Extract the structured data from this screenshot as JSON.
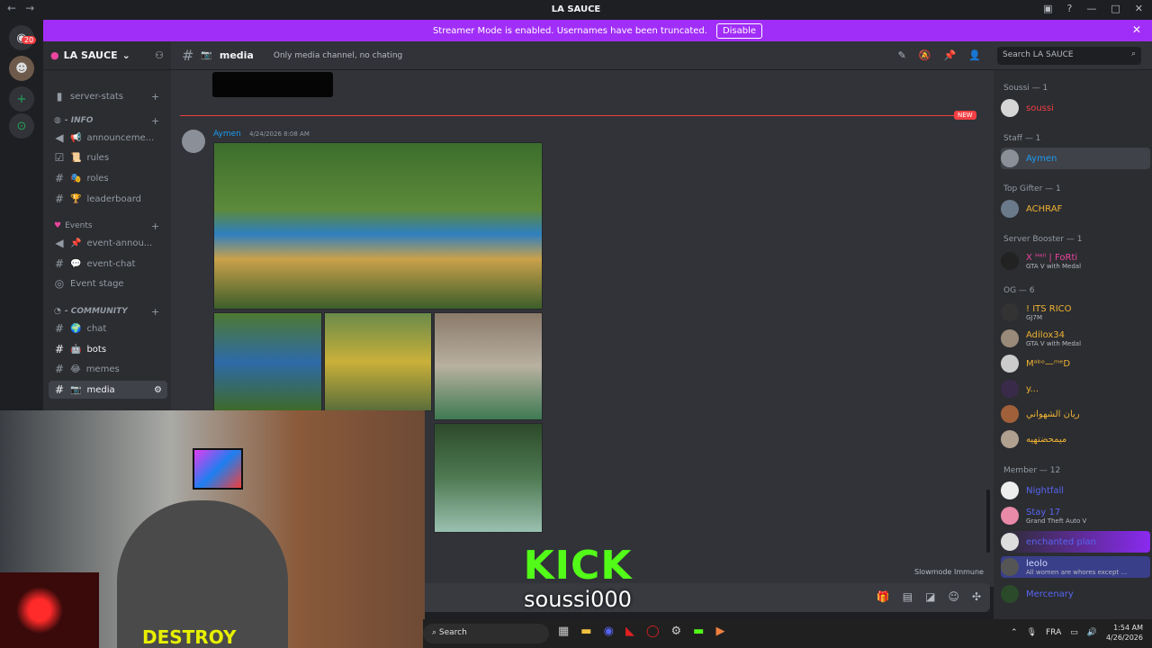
{
  "window": {
    "title": "LA SAUCE",
    "back": "←",
    "forward": "→"
  },
  "banner": {
    "text": "Streamer Mode is enabled. Usernames have been truncated.",
    "button": "Disable"
  },
  "rail": {
    "badge": "20"
  },
  "server": {
    "name": "LA SAUCE"
  },
  "channels": [
    {
      "label": "server-stats",
      "type": "stats"
    },
    {
      "cat": "- INFO"
    },
    {
      "label": "announceme...",
      "type": "announce",
      "emoji": "📢"
    },
    {
      "label": "rules",
      "type": "rules",
      "emoji": "📜"
    },
    {
      "label": "roles",
      "type": "text",
      "emoji": "🎭"
    },
    {
      "label": "leaderboard",
      "type": "text",
      "emoji": "🏆"
    },
    {
      "cat": "Events"
    },
    {
      "label": "event-annou...",
      "type": "announce",
      "emoji": "📌"
    },
    {
      "label": "event-chat",
      "type": "text",
      "emoji": "💬"
    },
    {
      "label": "Event stage",
      "type": "stage"
    },
    {
      "cat": "- COMMUNITY"
    },
    {
      "label": "chat",
      "type": "text",
      "emoji": "🌍"
    },
    {
      "label": "bots",
      "type": "text",
      "emoji": "🤖"
    },
    {
      "label": "memes",
      "type": "text",
      "emoji": "😂"
    },
    {
      "label": "media",
      "type": "text",
      "emoji": "📷"
    }
  ],
  "chatbar": {
    "channel": "media",
    "topic": "Only media channel, no chating",
    "search_placeholder": "Search LA SAUCE"
  },
  "message": {
    "author": "Aymen",
    "timestamp": "4/24/2026 8:08 AM",
    "new_tag": "NEW"
  },
  "composer": {
    "slowmode": "Slowmode Immune"
  },
  "members": {
    "groups": [
      {
        "title": "Soussi — 1",
        "items": [
          {
            "name": "soussi",
            "color": "#f23f43",
            "sub": ""
          }
        ]
      },
      {
        "title": "Staff — 1",
        "items": [
          {
            "name": "Aymen",
            "color": "#1d9bf0",
            "sub": ""
          }
        ]
      },
      {
        "title": "Top Gifter — 1",
        "items": [
          {
            "name": "ACHRAF",
            "color": "#f0b232",
            "sub": ""
          }
        ]
      },
      {
        "title": "Server Booster — 1",
        "items": [
          {
            "name": "X ᴴᵉˡˡ | FoRti",
            "color": "#eb459e",
            "sub": "GTA V with Medal"
          }
        ]
      },
      {
        "title": "OG — 6",
        "items": [
          {
            "name": "! ITS RICO",
            "color": "#f0b232",
            "sub": "GJ7M"
          },
          {
            "name": "Adilox34",
            "color": "#f0b232",
            "sub": "GTA V with Medal"
          },
          {
            "name": "Mᵃᵇᵒ—ᵐᵉD",
            "color": "#f0b232",
            "sub": ""
          },
          {
            "name": "y...",
            "color": "#f0b232",
            "sub": ""
          },
          {
            "name": "ريان الشهواني",
            "color": "#f0b232",
            "sub": ""
          },
          {
            "name": "ميمحضتهيه",
            "color": "#f0b232",
            "sub": ""
          }
        ]
      },
      {
        "title": "Member — 12",
        "items": [
          {
            "name": "Nightfall",
            "color": "#5865f2",
            "sub": ""
          },
          {
            "name": "Stay 17",
            "color": "#5865f2",
            "sub": "Grand Theft Auto V"
          },
          {
            "name": "enchanted plan",
            "color": "#5865f2",
            "sub": ""
          },
          {
            "name": "leolo",
            "color": "#5865f2",
            "sub": "All women are whores except ..."
          },
          {
            "name": "Mercenary",
            "color": "#5865f2",
            "sub": ""
          }
        ]
      }
    ]
  },
  "overlay": {
    "kick_logo": "KICK",
    "kick_user": "soussi000",
    "shirt": "DESTROY"
  },
  "taskbar": {
    "search": "Search",
    "lang": "FRA",
    "time": "1:54 AM",
    "date": "4/26/2026"
  },
  "colors": {
    "banner": "#a12ef8",
    "accent": "#5865f2",
    "kick_green": "#53fc18"
  }
}
